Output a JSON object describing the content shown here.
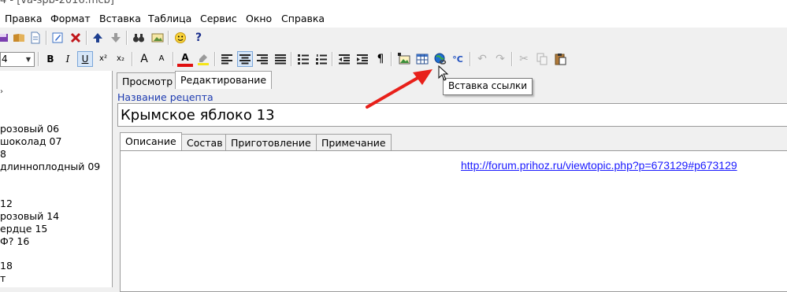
{
  "window": {
    "title": "4 - [va-spb-2016.mcb]"
  },
  "menu": [
    "Правка",
    "Формат",
    "Вставка",
    "Таблица",
    "Сервис",
    "Окно",
    "Справка"
  ],
  "format_toolbar": {
    "font_size": "4",
    "bold": "B",
    "italic": "I",
    "underline": "U",
    "superscript": "x²",
    "subscript": "x₂",
    "font_grow": "A",
    "font_shrink": "A",
    "font_color": "A",
    "pilcrow": "¶",
    "celsius": "°C"
  },
  "tooltip": "Вставка ссылки",
  "tree": {
    "items": [
      "розовый 06",
      "шоколад 07",
      "8",
      "длиннoплодный 09",
      "12",
      "розовый 14",
      "ердце 15",
      "Ф? 16",
      "18",
      "т"
    ]
  },
  "view_tabs": [
    "Просмотр",
    "Редактирование"
  ],
  "recipe": {
    "label": "Название рецепта",
    "name": "Крымское яблоко 13"
  },
  "section_tabs": [
    "Описание",
    "Состав",
    "Приготовление",
    "Примечание"
  ],
  "description": {
    "link": "http://forum.prihoz.ru/viewtopic.php?p=673129#p673129"
  },
  "colors": {
    "link": "#1a1aff",
    "label": "#1c3ab0",
    "arrow": "#e8201a",
    "pressed_button": "#d6e6f8"
  }
}
